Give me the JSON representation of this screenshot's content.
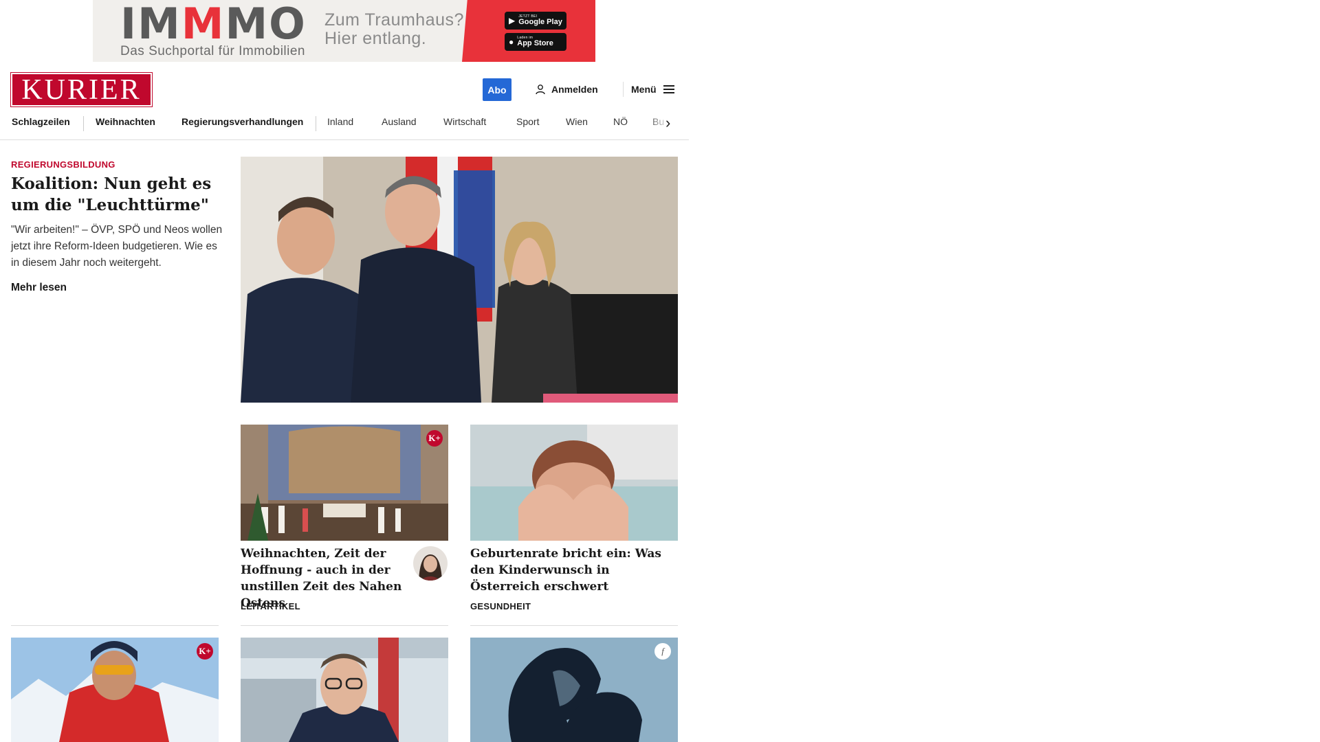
{
  "ad": {
    "logo_part1": "IM",
    "logo_part2": "M",
    "logo_part3": "MO",
    "subtitle": "Das Suchportal für Immobilien",
    "tagline_line1": "Zum Traumhaus?",
    "tagline_line2": "Hier entlang.",
    "google_small": "JETZT BEI",
    "google_label": "Google Play",
    "apple_small": "Laden im",
    "apple_label": "App Store",
    "colors": {
      "accent": "#e8323a",
      "background": "#f1efec"
    }
  },
  "header": {
    "logo_text": "KURIER",
    "abo_label": "Abo",
    "login_label": "Anmelden",
    "menu_label": "Menü",
    "colors": {
      "brand": "#c0082d",
      "abo": "#2468d6"
    }
  },
  "nav": {
    "items": [
      "Schlagzeilen",
      "Weihnachten",
      "Regierungsverhandlungen",
      "Inland",
      "Ausland",
      "Wirtschaft",
      "Sport",
      "Wien",
      "NÖ",
      "Bu"
    ]
  },
  "lead": {
    "kicker": "REGIERUNGSBILDUNG",
    "title": "Koalition: Nun geht es um die \"Leuchttürme\"",
    "teaser": "\"Wir arbeiten!\" – ÖVP, SPÖ und Neos wollen jetzt ihre Reform-Ideen budgetieren. Wie es in diesem Jahr noch weitergeht.",
    "more_label": "Mehr lesen"
  },
  "cards": [
    {
      "title": "Weihnachten, Zeit der Hoff­nung - auch in der unstillen Zeit des Nahen Ostens",
      "category": "LEITARTIKEL",
      "badge": "K+"
    },
    {
      "title": "Geburtenrate bricht ein: Was den Kinderwunsch in Österreich erschwert",
      "category": "GESUNDHEIT"
    }
  ],
  "bottom_row": {
    "badges": [
      "K+",
      "f"
    ]
  }
}
